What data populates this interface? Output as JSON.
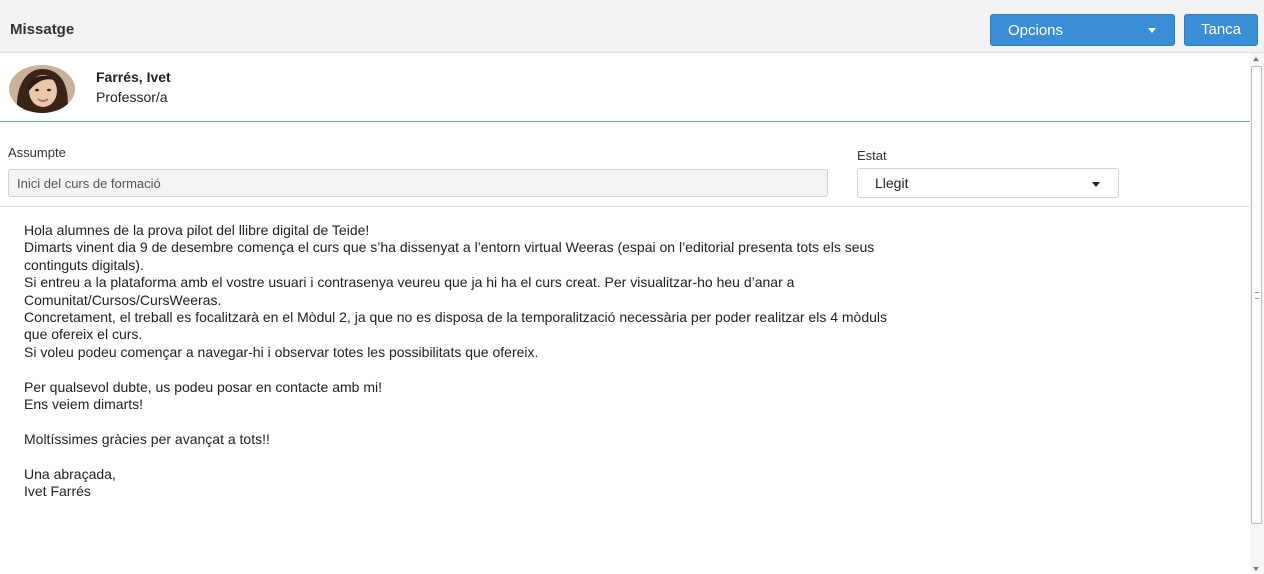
{
  "header": {
    "title": "Missatge",
    "options_label": "Opcions",
    "close_label": "Tanca"
  },
  "sender": {
    "name": "Farrés, Ivet",
    "role": "Professor/a"
  },
  "subject": {
    "label": "Assumpte",
    "value": "Inici del curs de formació"
  },
  "status": {
    "label": "Estat",
    "value": "Llegit"
  },
  "message": {
    "lines": [
      "Hola alumnes de la prova pilot del llibre digital de Teide!",
      "Dimarts vinent dia 9 de desembre comença el curs que s’ha dissenyat a l’entorn virtual Weeras (espai on l’editorial presenta tots els seus",
      "continguts digitals).",
      "Si entreu a la plataforma amb el vostre usuari i contrasenya veureu que ja hi ha el curs creat. Per visualitzar-ho heu d’anar a",
      "Comunitat/Cursos/CursWeeras.",
      "Concretament, el treball es focalitzarà en el Mòdul 2, ja que no es disposa de la temporalització necessària per poder realitzar els 4 mòduls",
      "que ofereix el curs.",
      "Si voleu podeu començar a navegar-hi i observar totes les possibilitats que ofereix.",
      "",
      "Per qualsevol dubte, us podeu posar en contacte amb mi!",
      "Ens veiem dimarts!",
      "",
      "Moltíssimes gràcies per avançat a tots!!",
      "",
      "Una abraçada,",
      "Ivet Farrés"
    ]
  },
  "colors": {
    "primary_button": "#3a8ed6",
    "header_bg": "#f2f2f2",
    "separator_accent": "#6a9fd4"
  }
}
